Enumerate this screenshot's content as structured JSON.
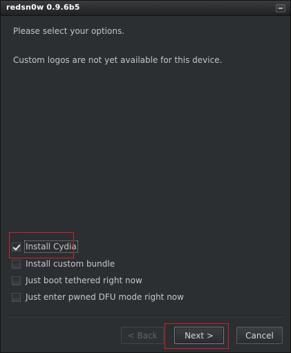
{
  "window": {
    "title": "redsn0w 0.9.6b5"
  },
  "main": {
    "prompt": "Please select your options.",
    "note": "Custom logos are not yet available for this device."
  },
  "options": [
    {
      "label": "Install Cydia",
      "checked": true
    },
    {
      "label": "Install custom bundle",
      "checked": false
    },
    {
      "label": "Just boot tethered right now",
      "checked": false
    },
    {
      "label": "Just enter pwned DFU mode right now",
      "checked": false
    }
  ],
  "buttons": {
    "back": {
      "label": "< Back",
      "enabled": false
    },
    "next": {
      "label": "Next >",
      "enabled": true
    },
    "cancel": {
      "label": "Cancel",
      "enabled": true
    }
  },
  "colors": {
    "window_bg": "#2c2f31",
    "highlight": "#d1222a",
    "text": "#c6c9cb"
  }
}
